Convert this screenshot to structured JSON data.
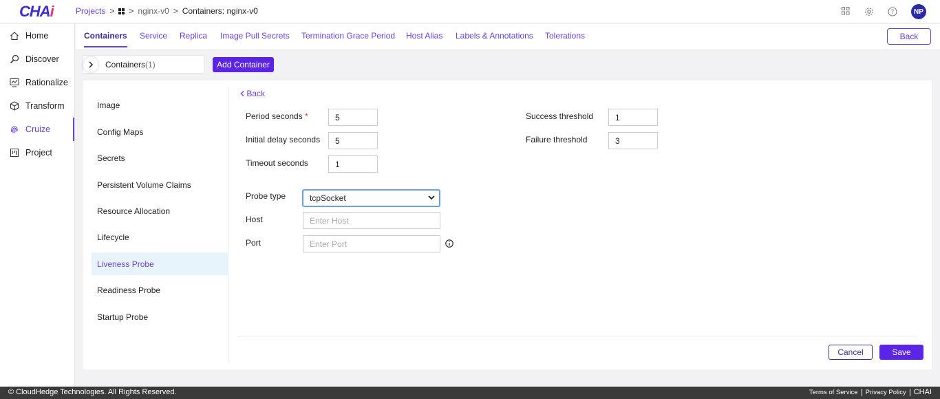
{
  "app": {
    "logo_main": "CHA",
    "logo_accent": "i"
  },
  "breadcrumb": {
    "projects": "Projects",
    "sep1": ">",
    "sep2": ">",
    "project": "nginx-v0",
    "sep3": ">",
    "current": "Containers: nginx-v0"
  },
  "topbar": {
    "avatar_initials": "NP"
  },
  "sidebar": {
    "items": [
      {
        "label": "Home",
        "icon": "home-icon"
      },
      {
        "label": "Discover",
        "icon": "search-icon"
      },
      {
        "label": "Rationalize",
        "icon": "chart-icon"
      },
      {
        "label": "Transform",
        "icon": "cube-icon"
      },
      {
        "label": "Cruize",
        "icon": "fingerprint-icon",
        "active": true
      },
      {
        "label": "Project",
        "icon": "board-icon"
      }
    ]
  },
  "tabs": [
    {
      "label": "Containers",
      "active": true
    },
    {
      "label": "Service"
    },
    {
      "label": "Replica"
    },
    {
      "label": "Image Pull Secrets"
    },
    {
      "label": "Termination Grace Period"
    },
    {
      "label": "Host Alias"
    },
    {
      "label": "Labels & Annotations"
    },
    {
      "label": "Tolerations"
    }
  ],
  "back_top_label": "Back",
  "containers": {
    "label": "Containers",
    "count": "(1)",
    "add_label": "Add Container"
  },
  "left_menu": [
    "Image",
    "Config Maps",
    "Secrets",
    "Persistent Volume Claims",
    "Resource Allocation",
    "Lifecycle",
    "Liveness Probe",
    "Readiness Probe",
    "Startup Probe"
  ],
  "left_menu_active": "Liveness Probe",
  "form": {
    "back_label": "Back",
    "period_seconds": {
      "label": "Period seconds",
      "required_mark": "*",
      "value": "5"
    },
    "initial_delay": {
      "label": "Initial delay seconds",
      "value": "5"
    },
    "timeout": {
      "label": "Timeout seconds",
      "value": "1"
    },
    "success_threshold": {
      "label": "Success threshold",
      "value": "1"
    },
    "failure_threshold": {
      "label": "Failure threshold",
      "value": "3"
    },
    "probe_type": {
      "label": "Probe type",
      "value": "tcpSocket"
    },
    "host": {
      "label": "Host",
      "placeholder": "Enter Host"
    },
    "port": {
      "label": "Port",
      "placeholder": "Enter Port"
    }
  },
  "actions": {
    "cancel": "Cancel",
    "save": "Save"
  },
  "footer": {
    "copyright": "© CloudHedge Technologies. All Rights Reserved.",
    "terms": "Terms of Service",
    "privacy": "Privacy Policy",
    "brand": "CHAI"
  },
  "colors": {
    "accent": "#6b3fdc",
    "primary_button": "#5b24e6",
    "active_menu_bg": "#e8f4fc",
    "footer_bg": "#3a3a3a"
  }
}
